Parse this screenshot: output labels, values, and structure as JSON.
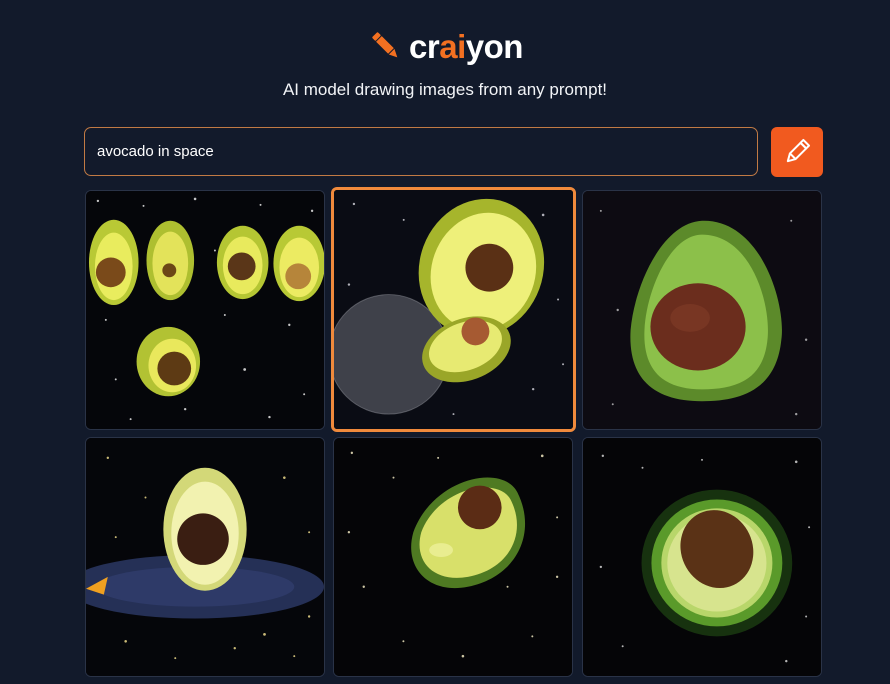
{
  "brand": {
    "logo_prefix": "cr",
    "logo_accent": "ai",
    "logo_suffix": "yon",
    "accent_color": "#f37021",
    "icon": "pencil-icon"
  },
  "tagline": "AI model drawing images from any prompt!",
  "search": {
    "value": "avocado in space",
    "button_icon": "pencil-icon",
    "button_color": "#f15a1f"
  },
  "results": {
    "selected_index": 1,
    "selection_color": "#f08a3c",
    "items": [
      {
        "subject": "avocado-halves-group"
      },
      {
        "subject": "avocado-with-moon"
      },
      {
        "subject": "avocado-half-closeup"
      },
      {
        "subject": "avocado-on-ring-planet"
      },
      {
        "subject": "avocado-half-floating"
      },
      {
        "subject": "glowing-avocado-half"
      }
    ]
  },
  "colors": {
    "background": "#121a2b",
    "input_border": "#c17a44"
  }
}
